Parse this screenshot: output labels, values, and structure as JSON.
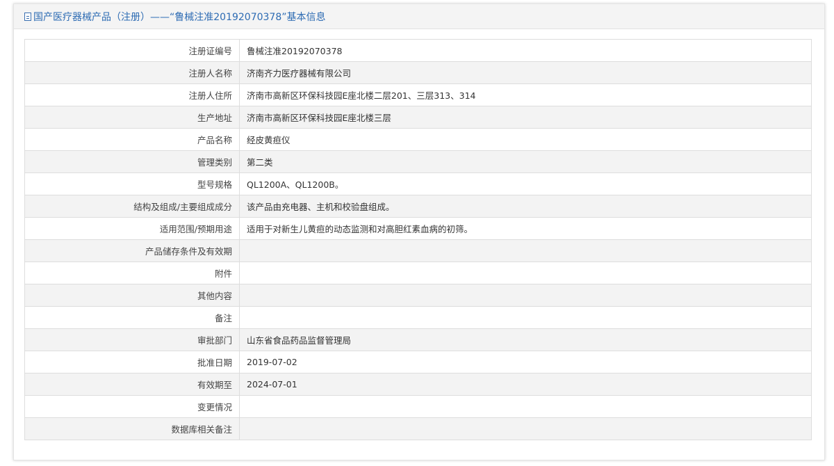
{
  "header": {
    "title": "国产医疗器械产品（注册）——“鲁械注准20192070378”基本信息"
  },
  "rows": [
    {
      "label": "注册证编号",
      "value": "鲁械注准20192070378"
    },
    {
      "label": "注册人名称",
      "value": "济南齐力医疗器械有限公司"
    },
    {
      "label": "注册人住所",
      "value": "济南市高新区环保科技园E座北楼二层201、三层313、314"
    },
    {
      "label": "生产地址",
      "value": "济南市高新区环保科技园E座北楼三层"
    },
    {
      "label": "产品名称",
      "value": "经皮黄疸仪"
    },
    {
      "label": "管理类别",
      "value": "第二类"
    },
    {
      "label": "型号规格",
      "value": "QL1200A、QL1200B。"
    },
    {
      "label": "结构及组成/主要组成成分",
      "value": "该产品由充电器、主机和校验盘组成。"
    },
    {
      "label": "适用范围/预期用途",
      "value": "适用于对新生儿黄疸的动态监测和对高胆红素血病的初筛。"
    },
    {
      "label": "产品储存条件及有效期",
      "value": ""
    },
    {
      "label": "附件",
      "value": ""
    },
    {
      "label": "其他内容",
      "value": ""
    },
    {
      "label": "备注",
      "value": ""
    },
    {
      "label": "审批部门",
      "value": "山东省食品药品监督管理局"
    },
    {
      "label": "批准日期",
      "value": "2019-07-02"
    },
    {
      "label": "有效期至",
      "value": "2024-07-01"
    },
    {
      "label": "变更情况",
      "value": ""
    },
    {
      "label": "数据库相关备注",
      "value": ""
    }
  ],
  "colors": {
    "title": "#2d6bb3",
    "header_bg": "#f4f4f4",
    "row_alt_bg": "#f3f3f3",
    "border": "#dddddd"
  },
  "icons": {
    "header_icon": "document-icon"
  }
}
